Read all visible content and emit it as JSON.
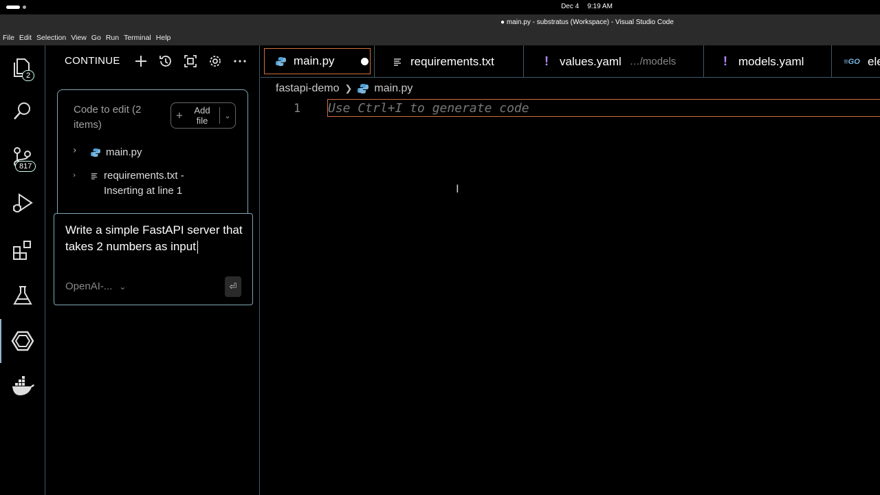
{
  "system": {
    "date": "Dec 4",
    "time": "9:19 AM"
  },
  "window": {
    "title": "● main.py - substratus (Workspace) - Visual Studio Code"
  },
  "menu": [
    "File",
    "Edit",
    "Selection",
    "View",
    "Go",
    "Run",
    "Terminal",
    "Help"
  ],
  "activity": {
    "explorer_badge": "2",
    "scm_badge": "817"
  },
  "sidebar": {
    "title": "CONTINUE",
    "code_to_edit": {
      "heading": "Code to edit (2 items)",
      "add_file_label": "Add file",
      "files": [
        {
          "name": "main.py"
        },
        {
          "name": "requirements.txt - Inserting at line 1"
        }
      ]
    },
    "prompt": {
      "text": "Write a simple FastAPI server that takes 2 numbers as input",
      "model": "OpenAI-..."
    }
  },
  "editor": {
    "tabs": [
      {
        "label": "main.py",
        "active": true,
        "modified": true
      },
      {
        "label": "requirements.txt"
      },
      {
        "label": "values.yaml",
        "sub": "…/models"
      },
      {
        "label": "models.yaml"
      },
      {
        "label": "ele"
      }
    ],
    "breadcrumb": {
      "folder": "fastapi-demo",
      "file": "main.py"
    },
    "line_number": "1",
    "ghost_text": "Use Ctrl+I to generate code"
  },
  "colors": {
    "accent_border": "#7fa9b4",
    "active_tab_border": "#d16f3d",
    "yaml_bang": "#b58bff",
    "python_blue": "#4f9fd4"
  }
}
